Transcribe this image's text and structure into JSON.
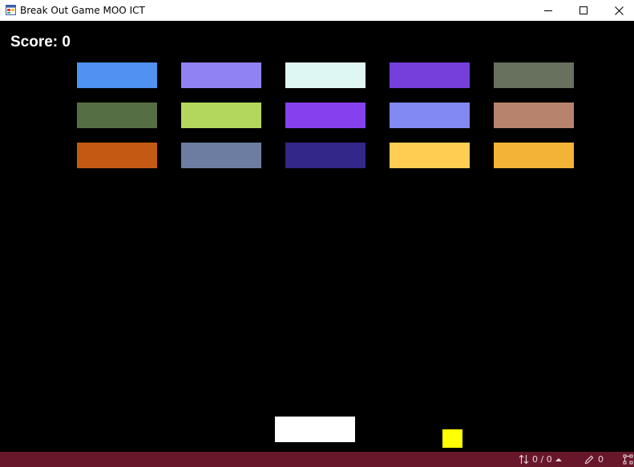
{
  "window": {
    "title": "Break Out Game MOO ICT",
    "icons": {
      "app": "app-window-icon",
      "minimize": "minimize-icon",
      "maximize": "maximize-icon",
      "close": "close-icon"
    }
  },
  "game": {
    "score_label": "Score: 0",
    "background_color": "#000000",
    "blocks": [
      {
        "row": 1,
        "col": 1,
        "color": "#4f92f0"
      },
      {
        "row": 1,
        "col": 2,
        "color": "#9182f4"
      },
      {
        "row": 1,
        "col": 3,
        "color": "#dff7f3"
      },
      {
        "row": 1,
        "col": 4,
        "color": "#763edb"
      },
      {
        "row": 1,
        "col": 5,
        "color": "#67715e"
      },
      {
        "row": 2,
        "col": 1,
        "color": "#566e44"
      },
      {
        "row": 2,
        "col": 2,
        "color": "#b3d75c"
      },
      {
        "row": 2,
        "col": 3,
        "color": "#8640ee"
      },
      {
        "row": 2,
        "col": 4,
        "color": "#8289f2"
      },
      {
        "row": 2,
        "col": 5,
        "color": "#b8836c"
      },
      {
        "row": 3,
        "col": 1,
        "color": "#c35a14"
      },
      {
        "row": 3,
        "col": 2,
        "color": "#6c7da1"
      },
      {
        "row": 3,
        "col": 3,
        "color": "#33278a"
      },
      {
        "row": 3,
        "col": 4,
        "color": "#fecd52"
      },
      {
        "row": 3,
        "col": 5,
        "color": "#f2b336"
      }
    ],
    "paddle_color": "#ffffff",
    "ball_color": "#ffff00"
  },
  "statusbar": {
    "background_color": "#68172a",
    "sort_count": "0 / 0",
    "edit_count": "0",
    "icons": {
      "sort": "sort-arrows-icon",
      "caret": "caret-up-icon",
      "pencil": "pencil-icon",
      "network": "network-icon"
    }
  }
}
